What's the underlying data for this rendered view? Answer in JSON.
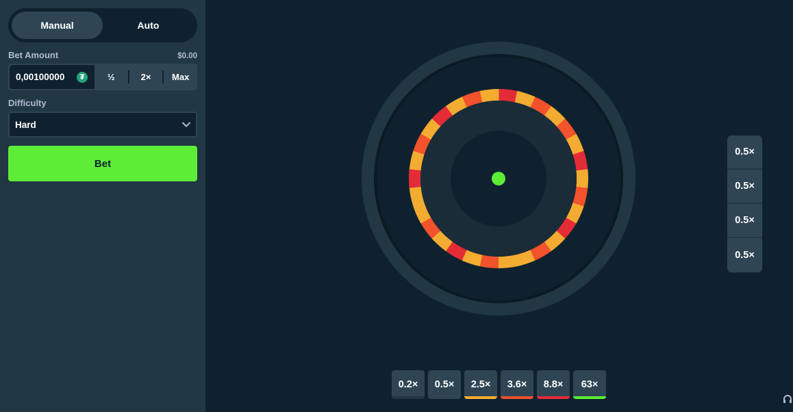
{
  "mode_toggle": {
    "manual_label": "Manual",
    "auto_label": "Auto",
    "active": "Manual"
  },
  "bet_amount": {
    "label": "Bet Amount",
    "usd_value": "$0.00",
    "value": "0,00100000",
    "currency_icon": "tether-icon",
    "half_label": "½",
    "double_label": "2×",
    "max_label": "Max"
  },
  "difficulty": {
    "label": "Difficulty",
    "selected": "Hard"
  },
  "bet_button_label": "Bet",
  "wheel": {
    "segments": [
      "#e42c37",
      "#f3ac31",
      "#f2522c",
      "#f3ac31",
      "#f2522c",
      "#f3ac31",
      "#e42c37",
      "#f3ac31",
      "#f2522c",
      "#f3ac31",
      "#e42c37",
      "#f3ac31",
      "#f2522c",
      "#f3ac31",
      "#f3ac31",
      "#f2522c",
      "#f3ac31",
      "#e42c37",
      "#f3ac31",
      "#f2522c",
      "#f3ac31",
      "#f3ac31",
      "#e42c37",
      "#f3ac31",
      "#f2522c",
      "#f3ac31",
      "#e42c37",
      "#f3ac31",
      "#f2522c",
      "#f3ac31"
    ],
    "center_dot_color": "#5ded36"
  },
  "recent_results": [
    "0.5×",
    "0.5×",
    "0.5×",
    "0.5×"
  ],
  "payouts": [
    {
      "label": "0.2×",
      "color": "#213743"
    },
    {
      "label": "0.5×",
      "color": "#2f4553"
    },
    {
      "label": "2.5×",
      "color": "#f3ac31"
    },
    {
      "label": "3.6×",
      "color": "#f2522c"
    },
    {
      "label": "8.8×",
      "color": "#e42c37"
    },
    {
      "label": "63×",
      "color": "#5ded36"
    }
  ],
  "colors": {
    "sidebar_bg": "#213743",
    "game_bg": "#0f212e",
    "accent_green": "#5ded36",
    "control_bg": "#2f4553"
  }
}
